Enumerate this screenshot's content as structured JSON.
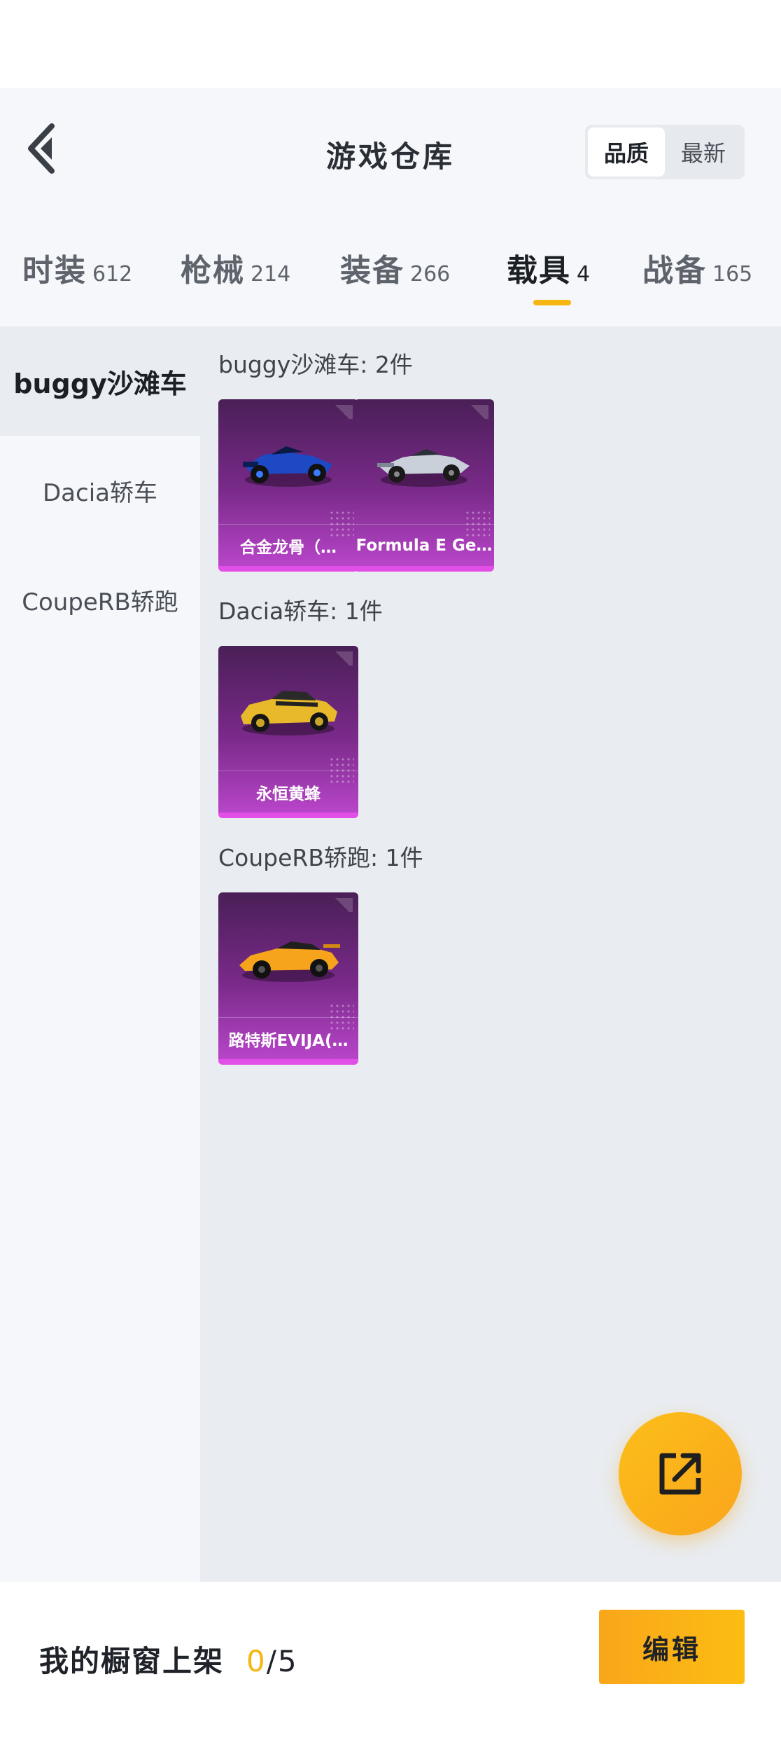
{
  "header": {
    "title": "游戏仓库",
    "sort_options": [
      "品质",
      "最新"
    ],
    "sort_selected": "品质"
  },
  "tabs": [
    {
      "label": "时装",
      "count": "612"
    },
    {
      "label": "枪械",
      "count": "214"
    },
    {
      "label": "装备",
      "count": "266"
    },
    {
      "label": "载具",
      "count": "4"
    },
    {
      "label": "战备",
      "count": "165"
    }
  ],
  "active_tab": "载具",
  "sidebar": {
    "items": [
      "buggy沙滩车",
      "Dacia轿车",
      "CoupeRB轿跑"
    ],
    "selected": "buggy沙滩车"
  },
  "groups": [
    {
      "title": "buggy沙滩车: 2件",
      "items": [
        {
          "name": "合金龙骨（…",
          "icon": "blue-buggy-car-icon",
          "color": "#2b5fd9"
        },
        {
          "name": "Formula E Ge…",
          "icon": "formula-e-car-icon",
          "color": "#9aa4b2"
        }
      ]
    },
    {
      "title": "Dacia轿车: 1件",
      "items": [
        {
          "name": "永恒黄蜂",
          "icon": "yellow-sedan-car-icon",
          "color": "#e8b92a"
        }
      ]
    },
    {
      "title": "CoupeRB轿跑: 1件",
      "items": [
        {
          "name": "路特斯EVIJA(…",
          "icon": "orange-sports-car-icon",
          "color": "#f5a41c"
        }
      ]
    }
  ],
  "fab": {
    "icon": "share-external-icon"
  },
  "bottom_bar": {
    "shelf_label": "我的橱窗上架",
    "shelf_used": "0",
    "shelf_total": "/5",
    "edit_label": "编辑"
  },
  "colors": {
    "accent": "#f6b60f",
    "card_purple": "#7a2a8a"
  }
}
